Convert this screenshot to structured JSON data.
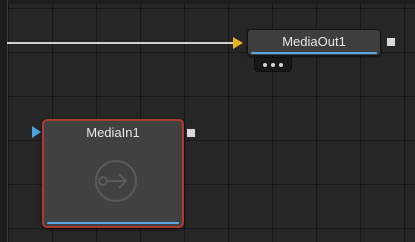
{
  "node_editor": {
    "nodes": [
      {
        "id": "media_out",
        "label": "MediaOut1",
        "selected": false
      },
      {
        "id": "media_in",
        "label": "MediaIn1",
        "selected": true
      }
    ],
    "icons": {
      "media_in_thumbnail": "media-in-icon",
      "input_arrow": "triangle-right-icon",
      "output_port": "square-port-icon",
      "options": "more-dots-icon"
    },
    "colors": {
      "background": "#262626",
      "connection": "#cfcfcf",
      "input_arrow_main": "#e8b21f",
      "input_arrow_media": "#4aa3de",
      "selected_border": "#b0392f",
      "node_underline": "#5aa7df"
    }
  }
}
